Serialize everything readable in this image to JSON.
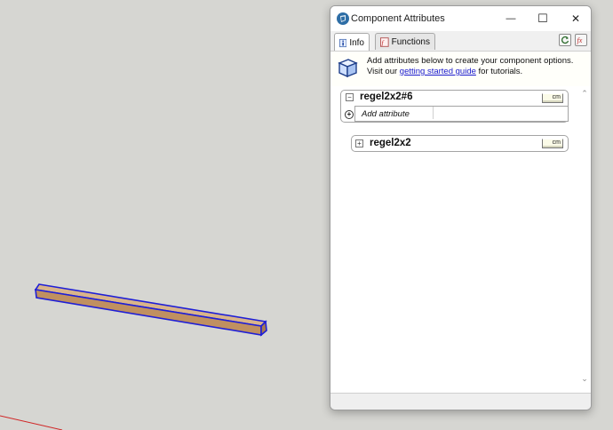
{
  "dialog": {
    "title": "Component Attributes",
    "minimize_glyph": "—",
    "maximize_glyph": "☐",
    "close_glyph": "✕"
  },
  "tabs": [
    {
      "label": "Info",
      "icon": "info-icon",
      "active": true
    },
    {
      "label": "Functions",
      "icon": "function-icon",
      "active": false
    }
  ],
  "toolbar": {
    "refresh_icon": "refresh-icon",
    "toggle_formula_icon": "formula-toggle-icon"
  },
  "infobar": {
    "text_before": "Add attributes below to create your component options. Visit our ",
    "link_text": "getting started guide",
    "text_after": " for tutorials."
  },
  "components": [
    {
      "name": "regel2x2#6",
      "expanded": true,
      "expander": "−",
      "unit": "cm"
    },
    {
      "name": "regel2x2",
      "expanded": false,
      "expander": "+",
      "unit": "cm"
    }
  ],
  "add_attribute": {
    "label": "Add attribute",
    "plus_glyph": "+"
  },
  "scroll": {
    "up": "⌃",
    "down": "⌄"
  },
  "colors": {
    "canvas": "#d6d6d2",
    "beam_fill": "#c8a173",
    "beam_outline": "#1f1fd6",
    "axis_red": "#d02828",
    "link": "#1a1acc"
  }
}
